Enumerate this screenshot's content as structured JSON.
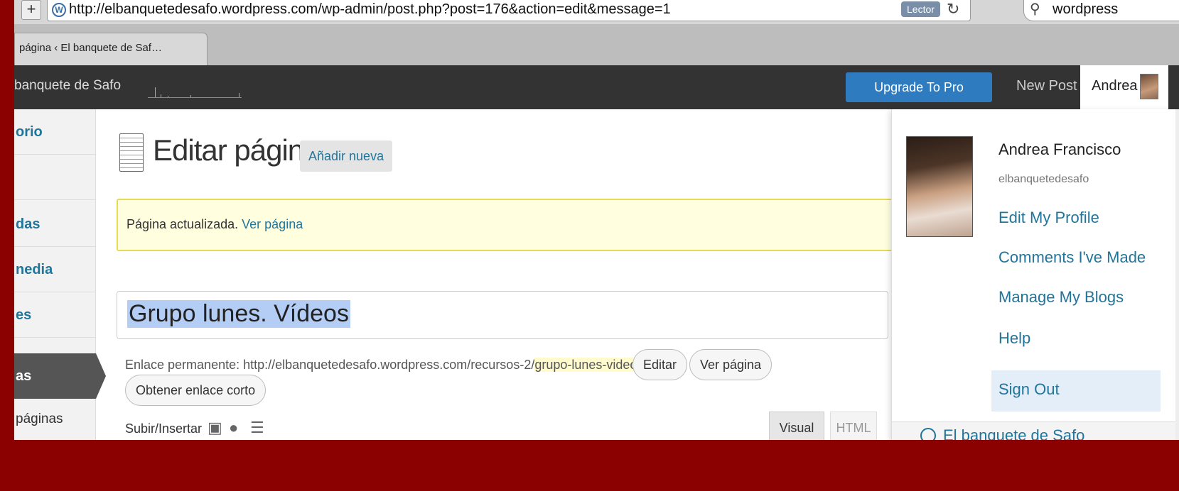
{
  "browser": {
    "url": "http://elbanquetedesafo.wordpress.com/wp-admin/post.php?post=176&action=edit&message=1",
    "reader_label": "Lector",
    "search_value": "wordpress",
    "tab_title": "página ‹ El banquete de Saf…"
  },
  "adminbar": {
    "site_name": "banquete de Safo",
    "upgrade_label": "Upgrade To Pro",
    "new_post_label": "New Post",
    "user_label": "Andrea"
  },
  "sidemenu": {
    "items": [
      {
        "label": "orio"
      },
      {
        "label": ""
      },
      {
        "label": "das"
      },
      {
        "label": "nedia"
      },
      {
        "label": "es"
      }
    ],
    "active_label": "as",
    "submenu_label": "páginas"
  },
  "main": {
    "page_title": "Editar página",
    "add_new_label": "Añadir nueva",
    "notice_text": "Página actualizada.",
    "notice_link": "Ver página",
    "post_title": "Grupo lunes. Vídeos",
    "permalink_prefix": "Enlace permanente: http://elbanquetedesafo.wordpress.com/recursos-2/",
    "permalink_slug": "grupo-lunes-videos",
    "permalink_suffix": "/",
    "edit_label": "Editar",
    "view_label": "Ver página",
    "shortlink_label": "Obtener enlace corto",
    "upload_label": "Subir/Insertar",
    "visual_tab": "Visual",
    "html_tab": "HTML"
  },
  "dropdown": {
    "full_name": "Andrea Francisco",
    "username": "elbanquetedesafo",
    "links": [
      "Edit My Profile",
      "Comments I've Made",
      "Manage My Blogs",
      "Help"
    ],
    "signout_label": "Sign Out",
    "footer_text": "El banquete de Safo"
  },
  "colors": {
    "outer_frame": "#8b0000",
    "adminbar": "#333333",
    "link": "#21759b",
    "upgrade": "#2e7cbf",
    "notice_bg": "#ffffe0"
  }
}
